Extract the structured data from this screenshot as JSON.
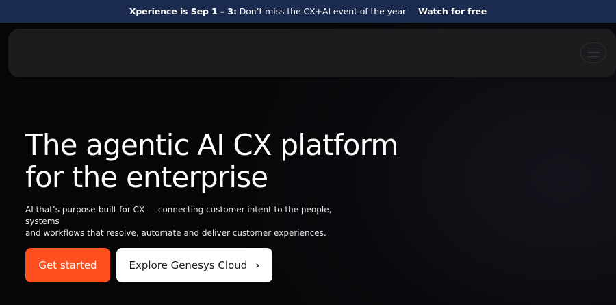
{
  "announcement": {
    "event_name": "Xperience is Sep 1 – 3:",
    "message": " Don’t miss the CX+AI event of the year",
    "cta_label": "Watch for free"
  },
  "nav": {
    "menu_icon": "hamburger-menu-icon"
  },
  "hero": {
    "title_line1": "The agentic AI CX platform",
    "title_line2": "for the enterprise",
    "subtitle_line1": "AI that’s purpose-built for CX — connecting customer intent to the people, systems",
    "subtitle_line2": "and workflows that resolve, automate and deliver customer experiences.",
    "primary_button": "Get started",
    "secondary_button": "Explore Genesys Cloud",
    "secondary_icon": "chevron-right-icon"
  },
  "colors": {
    "announce_bg": "#1a2b4f",
    "primary": "#ff4f1f",
    "background": "#08080b",
    "nav_bg": "#1c1c1f"
  }
}
